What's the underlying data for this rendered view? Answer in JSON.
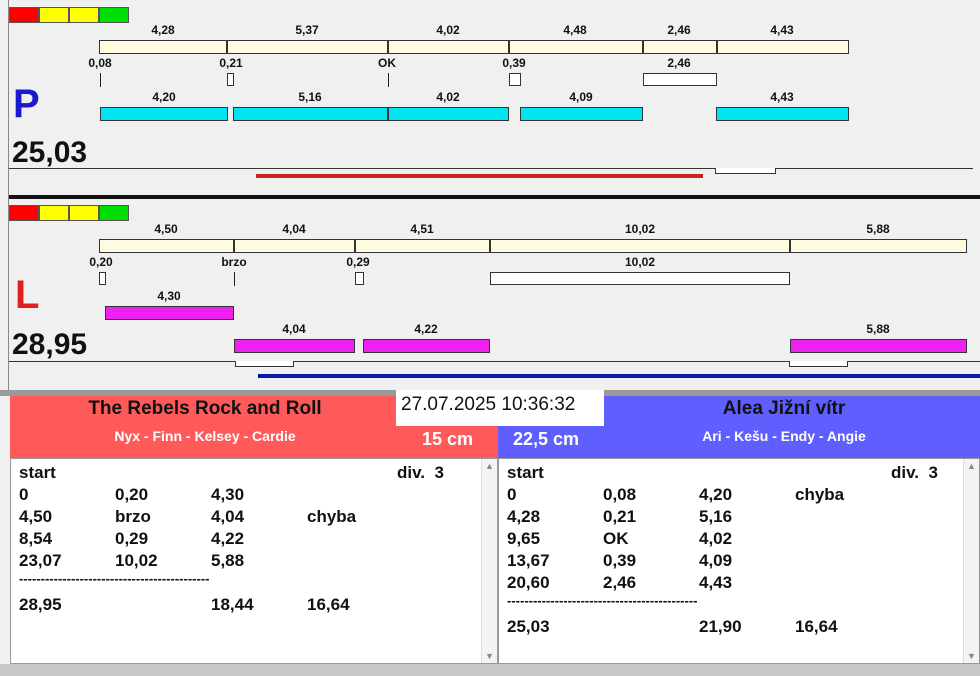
{
  "colors": {
    "red_panel": "#ff5a5a",
    "blue_panel": "#5f5fff",
    "cyan": "#00e5f0",
    "magenta": "#ee22ee",
    "cream": "#fffbe0",
    "red_line": "#cc2222",
    "blue_line": "#0a1aa8"
  },
  "lane_p": {
    "letter": "P",
    "total": "25,03",
    "top_labels": [
      "4,28",
      "5,37",
      "4,02",
      "4,48",
      "2,46",
      "4,43"
    ],
    "mid_labels": [
      "0,08",
      "0,21",
      "OK",
      "0,39",
      "2,46"
    ],
    "bottom_labels": [
      "4,20",
      "5,16",
      "4,02",
      "4,09",
      "4,43"
    ]
  },
  "lane_l": {
    "letter": "L",
    "total": "28,95",
    "top_labels": [
      "4,50",
      "4,04",
      "4,51",
      "10,02",
      "5,88"
    ],
    "mid_labels": [
      "0,20",
      "brzo",
      "0,29",
      "10,02"
    ],
    "row1_labels": [
      "4,30"
    ],
    "row2_labels": [
      "4,04",
      "4,22",
      "5,88"
    ]
  },
  "datetime": "27.07.2025 10:36:32",
  "left_team": {
    "name": "The Rebels Rock and Roll",
    "members": "Nyx - Finn - Kelsey - Cardie",
    "distance": "15 cm",
    "start": "start",
    "division": "div.  3",
    "rows": [
      [
        "0",
        "0,20",
        "4,30",
        ""
      ],
      [
        "4,50",
        "brzo",
        "4,04",
        "chyba"
      ],
      [
        "8,54",
        "0,29",
        "4,22",
        ""
      ],
      [
        "23,07",
        "10,02",
        "5,88",
        ""
      ]
    ],
    "separator": "--------------------------------------------",
    "totals": [
      "28,95",
      "",
      "18,44",
      "16,64"
    ]
  },
  "right_team": {
    "name": "Alea Jižní vítr",
    "members": "Ari - Kešu - Endy - Angie",
    "distance": "22,5 cm",
    "start": "start",
    "division": "div.  3",
    "rows": [
      [
        "0",
        "0,08",
        "4,20",
        "chyba"
      ],
      [
        "4,28",
        "0,21",
        "5,16",
        ""
      ],
      [
        "9,65",
        "OK",
        "4,02",
        ""
      ],
      [
        "13,67",
        "0,39",
        "4,09",
        ""
      ],
      [
        "20,60",
        "2,46",
        "4,43",
        ""
      ]
    ],
    "separator": "--------------------------------------------",
    "totals": [
      "25,03",
      "",
      "21,90",
      "16,64"
    ]
  }
}
